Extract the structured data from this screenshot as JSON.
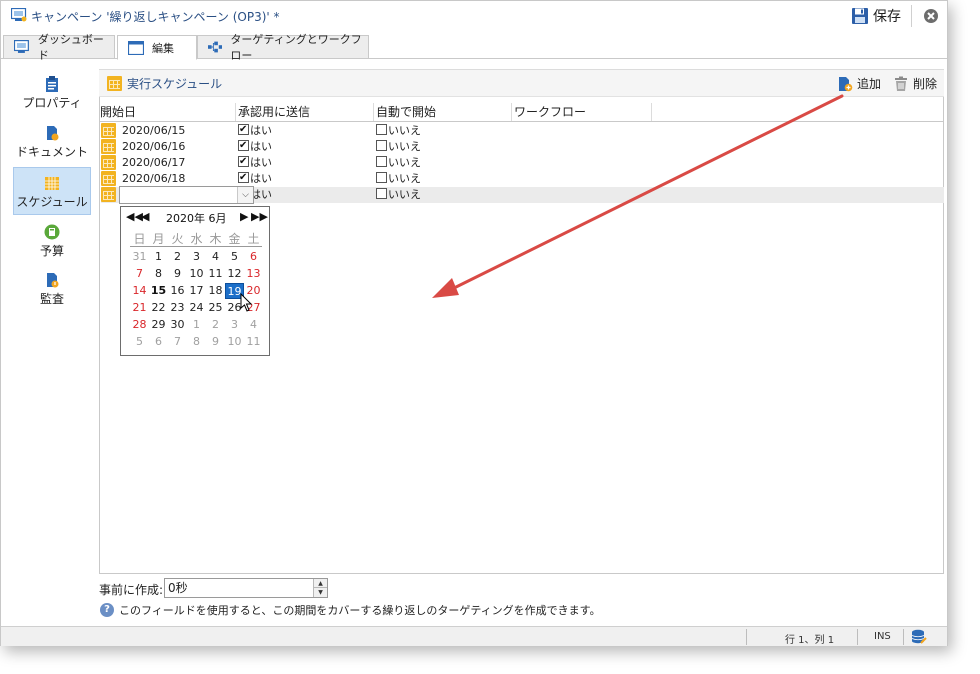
{
  "window": {
    "title": "キャンペーン '繰り返しキャンペーン (OP3)' *",
    "save_label": "保存"
  },
  "tabs": [
    {
      "label": "ダッシュボード"
    },
    {
      "label": "編集"
    },
    {
      "label": "ターゲティングとワークフロー"
    }
  ],
  "sidebar": {
    "items": [
      {
        "label": "プロパティ",
        "icon": "clipboard-icon"
      },
      {
        "label": "ドキュメント",
        "icon": "document-icon"
      },
      {
        "label": "スケジュール",
        "icon": "calendar-icon"
      },
      {
        "label": "予算",
        "icon": "calculator-icon"
      },
      {
        "label": "監査",
        "icon": "audit-icon"
      }
    ]
  },
  "section": {
    "title": "実行スケジュール",
    "add_label": "追加",
    "delete_label": "削除"
  },
  "table": {
    "columns": [
      "開始日",
      "承認用に送信",
      "自動で開始",
      "ワークフロー"
    ],
    "rows": [
      {
        "date": "2020/06/15",
        "approval": "はい",
        "auto": "いいえ",
        "workflow": ""
      },
      {
        "date": "2020/06/16",
        "approval": "はい",
        "auto": "いいえ",
        "workflow": ""
      },
      {
        "date": "2020/06/17",
        "approval": "はい",
        "auto": "いいえ",
        "workflow": ""
      },
      {
        "date": "2020/06/18",
        "approval": "はい",
        "auto": "いいえ",
        "workflow": ""
      },
      {
        "date": "",
        "approval": "はい",
        "auto": "いいえ",
        "workflow": ""
      }
    ]
  },
  "calendar": {
    "month_label": "2020年 6月",
    "weekdays": [
      "日",
      "月",
      "火",
      "水",
      "木",
      "金",
      "土"
    ],
    "weeks": [
      [
        "31",
        "1",
        "2",
        "3",
        "4",
        "5",
        "6"
      ],
      [
        "7",
        "8",
        "9",
        "10",
        "11",
        "12",
        "13"
      ],
      [
        "14",
        "15",
        "16",
        "17",
        "18",
        "19",
        "20"
      ],
      [
        "21",
        "22",
        "23",
        "24",
        "25",
        "26",
        "27"
      ],
      [
        "28",
        "29",
        "30",
        "1",
        "2",
        "3",
        "4"
      ],
      [
        "5",
        "6",
        "7",
        "8",
        "9",
        "10",
        "11"
      ]
    ],
    "selected_day": "19",
    "today": "15"
  },
  "bottom": {
    "precreate_label": "事前に作成:",
    "precreate_value": "0秒",
    "help_text": "このフィールドを使用すると、この期間をカバーする繰り返しのターゲティングを作成できます。"
  },
  "status": {
    "position": "行 1、列 1",
    "mode": "INS"
  },
  "colors": {
    "accent_blue": "#2a4f84",
    "selection_blue": "#1c6fc9",
    "calendar_gold": "#f2b320",
    "weekend_red": "#d9262a",
    "arrow_red": "#d94a45"
  }
}
